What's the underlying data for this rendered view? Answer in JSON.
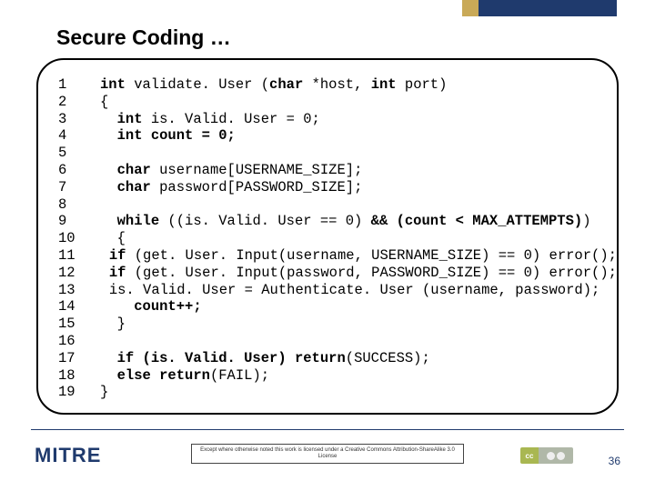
{
  "slide": {
    "title": "Secure Coding …",
    "page_number": "36",
    "logo_text": "MITRE",
    "license_text": "Except where otherwise noted this work is licensed under a Creative Commons Attribution-ShareAlike 3.0 License"
  },
  "code": {
    "lines": [
      {
        "n": "1",
        "seg": [
          [
            "kw",
            "int"
          ],
          [
            "",
            " validate. User ("
          ],
          [
            "kw",
            "char"
          ],
          [
            "",
            " *host, "
          ],
          [
            "kw",
            "int"
          ],
          [
            "",
            " port)"
          ]
        ]
      },
      {
        "n": "2",
        "seg": [
          [
            "",
            "{"
          ]
        ]
      },
      {
        "n": "3",
        "seg": [
          [
            "",
            "  "
          ],
          [
            "kw",
            "int"
          ],
          [
            "",
            " is. Valid. User = 0;"
          ]
        ]
      },
      {
        "n": "4",
        "seg": [
          [
            "",
            "  "
          ],
          [
            "kw",
            "int count = 0;"
          ]
        ]
      },
      {
        "n": "5",
        "seg": [
          [
            "",
            ""
          ]
        ]
      },
      {
        "n": "6",
        "seg": [
          [
            "",
            "  "
          ],
          [
            "kw",
            "char"
          ],
          [
            "",
            " username[USERNAME_SIZE];"
          ]
        ]
      },
      {
        "n": "7",
        "seg": [
          [
            "",
            "  "
          ],
          [
            "kw",
            "char"
          ],
          [
            "",
            " password[PASSWORD_SIZE];"
          ]
        ]
      },
      {
        "n": "8",
        "seg": [
          [
            "",
            ""
          ]
        ]
      },
      {
        "n": "9",
        "seg": [
          [
            "",
            "  "
          ],
          [
            "kw",
            "while"
          ],
          [
            "",
            " ((is. Valid. User == 0) "
          ],
          [
            "kw",
            "&& (count < MAX_ATTEMPTS)"
          ],
          [
            "",
            ")"
          ]
        ]
      },
      {
        "n": "10",
        "seg": [
          [
            "",
            "  {"
          ]
        ]
      },
      {
        "n": "11",
        "seg": [
          [
            "",
            "    "
          ],
          [
            "kw",
            "if"
          ],
          [
            "",
            " (get. User. Input(username, USERNAME_SIZE) == 0) error();"
          ]
        ]
      },
      {
        "n": "12",
        "seg": [
          [
            "",
            "    "
          ],
          [
            "kw",
            "if"
          ],
          [
            "",
            " (get. User. Input(password, PASSWORD_SIZE) == 0) error();"
          ]
        ]
      },
      {
        "n": "13",
        "seg": [
          [
            "",
            "    is. Valid. User = Authenticate. User (username, password);"
          ]
        ]
      },
      {
        "n": "14",
        "seg": [
          [
            "",
            "    "
          ],
          [
            "kw",
            "count++;"
          ]
        ]
      },
      {
        "n": "15",
        "seg": [
          [
            "",
            "  }"
          ]
        ]
      },
      {
        "n": "16",
        "seg": [
          [
            "",
            ""
          ]
        ]
      },
      {
        "n": "17",
        "seg": [
          [
            "",
            "  "
          ],
          [
            "kw",
            "if (is. Valid. User)"
          ],
          [
            "",
            " "
          ],
          [
            "kw",
            "return"
          ],
          [
            "",
            "(SUCCESS);"
          ]
        ]
      },
      {
        "n": "18",
        "seg": [
          [
            "",
            "  "
          ],
          [
            "kw",
            "else return"
          ],
          [
            "",
            "(FAIL);"
          ]
        ]
      },
      {
        "n": "19",
        "seg": [
          [
            "",
            "}"
          ]
        ]
      }
    ]
  }
}
